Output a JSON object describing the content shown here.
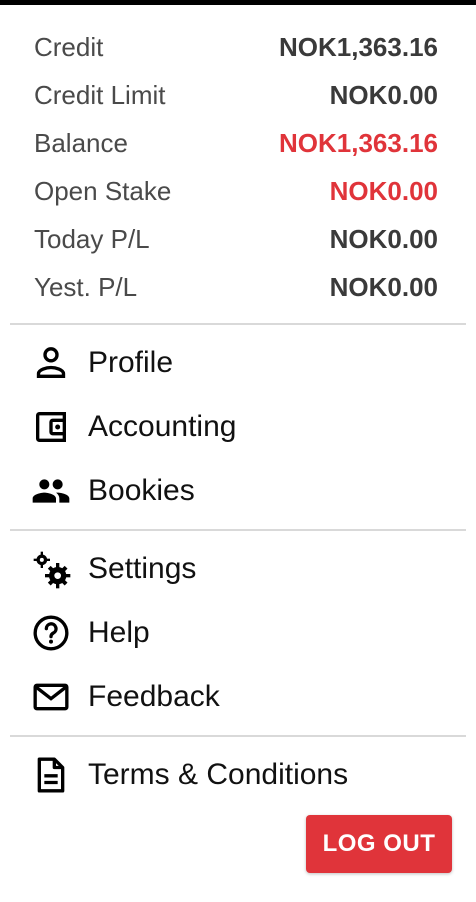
{
  "summary": [
    {
      "label": "Credit",
      "value": "NOK1,363.16",
      "negative": false
    },
    {
      "label": "Credit Limit",
      "value": "NOK0.00",
      "negative": false
    },
    {
      "label": "Balance",
      "value": "NOK1,363.16",
      "negative": true
    },
    {
      "label": "Open Stake",
      "value": "NOK0.00",
      "negative": true
    },
    {
      "label": "Today P/L",
      "value": "NOK0.00",
      "negative": false
    },
    {
      "label": "Yest. P/L",
      "value": "NOK0.00",
      "negative": false
    }
  ],
  "menu": {
    "account": [
      {
        "label": "Profile",
        "icon": "person-icon"
      },
      {
        "label": "Accounting",
        "icon": "wallet-icon"
      },
      {
        "label": "Bookies",
        "icon": "group-icon"
      }
    ],
    "support": [
      {
        "label": "Settings",
        "icon": "gears-icon"
      },
      {
        "label": "Help",
        "icon": "help-circle-icon"
      },
      {
        "label": "Feedback",
        "icon": "mail-icon"
      }
    ],
    "legal": [
      {
        "label": "Terms & Conditions",
        "icon": "document-icon"
      }
    ]
  },
  "logout_label": "LOG OUT",
  "colors": {
    "accent": "#e0343a",
    "text": "#111111",
    "label": "#4a4a4a",
    "divider": "#d9d9d9"
  }
}
